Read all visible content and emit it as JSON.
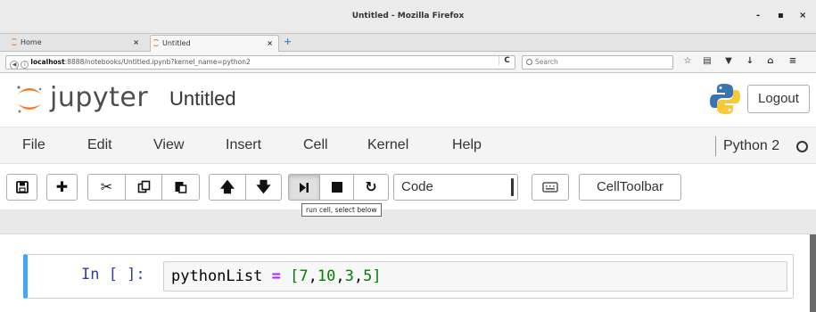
{
  "window": {
    "title": "Untitled - Mozilla Firefox",
    "controls": [
      "-",
      "▪",
      "×"
    ]
  },
  "tabs": [
    {
      "label": "Home",
      "close": "×"
    },
    {
      "label": "Untitled",
      "close": "×"
    }
  ],
  "new_tab_symbol": "+",
  "navbar": {
    "url_host": "localhost",
    "url_rest": ":8888/notebooks/Untitled.ipynb?kernel_name=python2",
    "reload_symbol": "C",
    "search_placeholder": "Search",
    "icons": [
      "bookmark-star-icon",
      "reading-list-icon",
      "pocket-icon",
      "download-icon",
      "home-icon",
      "menu-icon"
    ]
  },
  "jupyter": {
    "logo_text": "jupyter",
    "notebook_name": "Untitled",
    "logout_label": "Logout",
    "brand_color": "#f37726"
  },
  "menu": {
    "items": [
      "File",
      "Edit",
      "View",
      "Insert",
      "Cell",
      "Kernel",
      "Help"
    ],
    "kernel_name": "Python 2"
  },
  "toolbar": {
    "buttons": [
      {
        "name": "save-button",
        "icon": "save-icon"
      },
      {
        "name": "insert-cell-below-button",
        "icon": "plus-icon"
      },
      {
        "name": "cut-button",
        "icon": "scissors-icon"
      },
      {
        "name": "copy-button",
        "icon": "copy-icon"
      },
      {
        "name": "paste-button",
        "icon": "paste-icon"
      },
      {
        "name": "move-up-button",
        "icon": "arrow-up-icon"
      },
      {
        "name": "move-down-button",
        "icon": "arrow-down-icon"
      },
      {
        "name": "run-cell-button",
        "icon": "step-forward-icon"
      },
      {
        "name": "interrupt-button",
        "icon": "stop-icon"
      },
      {
        "name": "restart-button",
        "icon": "restart-icon"
      },
      {
        "name": "command-palette-button",
        "icon": "keyboard-icon"
      }
    ],
    "cell_type": "Code",
    "celltoolbar_label": "CellToolbar",
    "tooltip": "run cell, select below"
  },
  "cell": {
    "prompt": "In [ ]:",
    "code": {
      "identifier": "pythonList",
      "operator": "=",
      "open_bracket": "[",
      "numbers": [
        "7",
        "10",
        "3",
        "5"
      ],
      "close_bracket": "]"
    },
    "selected_border_color": "#42a5f5"
  }
}
